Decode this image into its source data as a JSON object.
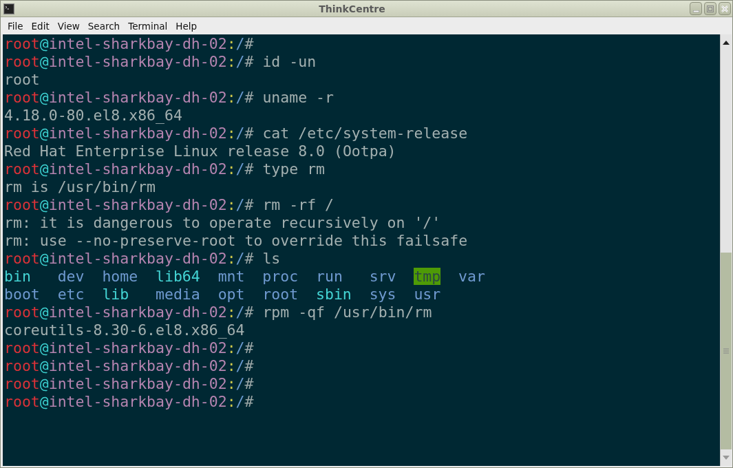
{
  "window": {
    "title": "ThinkCentre"
  },
  "menu": [
    "File",
    "Edit",
    "View",
    "Search",
    "Terminal",
    "Help"
  ],
  "terminal": {
    "lines": [
      {
        "kind": "prompt",
        "user": "root",
        "at": "@",
        "host": "intel-sharkbay-dh-02",
        "colon": ":",
        "path": "/",
        "sign": "#"
      },
      {
        "kind": "prompt",
        "user": "root",
        "at": "@",
        "host": "intel-sharkbay-dh-02",
        "colon": ":",
        "path": "/",
        "sign": "#",
        "command": "id -un"
      },
      {
        "kind": "output",
        "text": "root"
      },
      {
        "kind": "prompt",
        "user": "root",
        "at": "@",
        "host": "intel-sharkbay-dh-02",
        "colon": ":",
        "path": "/",
        "sign": "#",
        "command": "uname -r"
      },
      {
        "kind": "output",
        "text": "4.18.0-80.el8.x86_64"
      },
      {
        "kind": "prompt",
        "user": "root",
        "at": "@",
        "host": "intel-sharkbay-dh-02",
        "colon": ":",
        "path": "/",
        "sign": "#",
        "command": "cat /etc/system-release"
      },
      {
        "kind": "output",
        "text": "Red Hat Enterprise Linux release 8.0 (Ootpa)"
      },
      {
        "kind": "prompt",
        "user": "root",
        "at": "@",
        "host": "intel-sharkbay-dh-02",
        "colon": ":",
        "path": "/",
        "sign": "#",
        "command": "type rm"
      },
      {
        "kind": "output",
        "text": "rm is /usr/bin/rm"
      },
      {
        "kind": "prompt",
        "user": "root",
        "at": "@",
        "host": "intel-sharkbay-dh-02",
        "colon": ":",
        "path": "/",
        "sign": "#",
        "command": "rm -rf /"
      },
      {
        "kind": "output",
        "text": "rm: it is dangerous to operate recursively on '/'"
      },
      {
        "kind": "output",
        "text": "rm: use --no-preserve-root to override this failsafe"
      },
      {
        "kind": "prompt",
        "user": "root",
        "at": "@",
        "host": "intel-sharkbay-dh-02",
        "colon": ":",
        "path": "/",
        "sign": "#",
        "command": "ls"
      },
      {
        "kind": "listing",
        "entries": [
          {
            "name": "bin",
            "kind": "link"
          },
          {
            "name": "dev",
            "kind": "dir"
          },
          {
            "name": "home",
            "kind": "dir"
          },
          {
            "name": "lib64",
            "kind": "link"
          },
          {
            "name": "mnt",
            "kind": "dir"
          },
          {
            "name": "proc",
            "kind": "dir"
          },
          {
            "name": "run",
            "kind": "dir"
          },
          {
            "name": "srv",
            "kind": "dir"
          },
          {
            "name": "tmp",
            "kind": "sticky"
          },
          {
            "name": "var",
            "kind": "dir"
          }
        ]
      },
      {
        "kind": "listing",
        "entries": [
          {
            "name": "boot",
            "kind": "dir"
          },
          {
            "name": "etc",
            "kind": "dir"
          },
          {
            "name": "lib",
            "kind": "link"
          },
          {
            "name": "media",
            "kind": "dir"
          },
          {
            "name": "opt",
            "kind": "dir"
          },
          {
            "name": "root",
            "kind": "dir"
          },
          {
            "name": "sbin",
            "kind": "link"
          },
          {
            "name": "sys",
            "kind": "dir"
          },
          {
            "name": "usr",
            "kind": "dir"
          }
        ]
      },
      {
        "kind": "prompt",
        "user": "root",
        "at": "@",
        "host": "intel-sharkbay-dh-02",
        "colon": ":",
        "path": "/",
        "sign": "#",
        "command": "rpm -qf /usr/bin/rm"
      },
      {
        "kind": "output",
        "text": "coreutils-8.30-6.el8.x86_64"
      },
      {
        "kind": "prompt",
        "user": "root",
        "at": "@",
        "host": "intel-sharkbay-dh-02",
        "colon": ":",
        "path": "/",
        "sign": "#"
      },
      {
        "kind": "prompt",
        "user": "root",
        "at": "@",
        "host": "intel-sharkbay-dh-02",
        "colon": ":",
        "path": "/",
        "sign": "#"
      },
      {
        "kind": "prompt",
        "user": "root",
        "at": "@",
        "host": "intel-sharkbay-dh-02",
        "colon": ":",
        "path": "/",
        "sign": "#"
      },
      {
        "kind": "prompt",
        "user": "root",
        "at": "@",
        "host": "intel-sharkbay-dh-02",
        "colon": ":",
        "path": "/",
        "sign": "#"
      }
    ]
  }
}
